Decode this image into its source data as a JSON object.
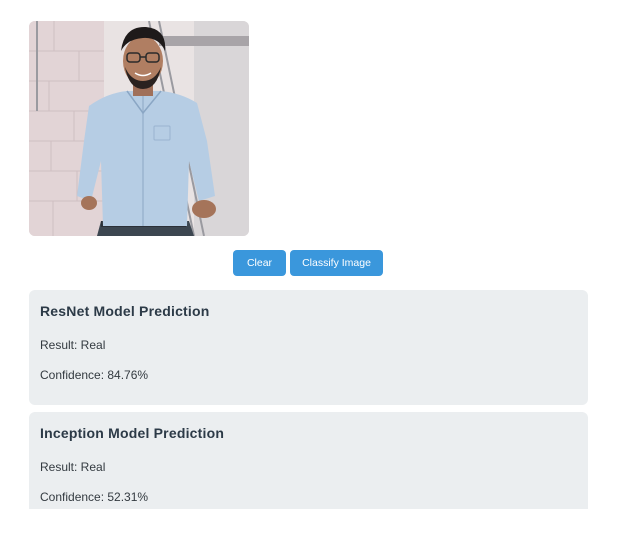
{
  "photo": {
    "alt": "Uploaded portrait photo"
  },
  "actions": {
    "clear_label": "Clear",
    "classify_label": "Classify Image"
  },
  "predictions": [
    {
      "title": "ResNet Model Prediction",
      "result_text": "Result: Real",
      "confidence_text": "Confidence: 84.76%"
    },
    {
      "title": "Inception Model Prediction",
      "result_text": "Result: Real",
      "confidence_text": "Confidence: 52.31%"
    }
  ],
  "colors": {
    "button": "#3a97dc",
    "card_background": "#ebeef0",
    "heading_text": "#2c3a47"
  }
}
